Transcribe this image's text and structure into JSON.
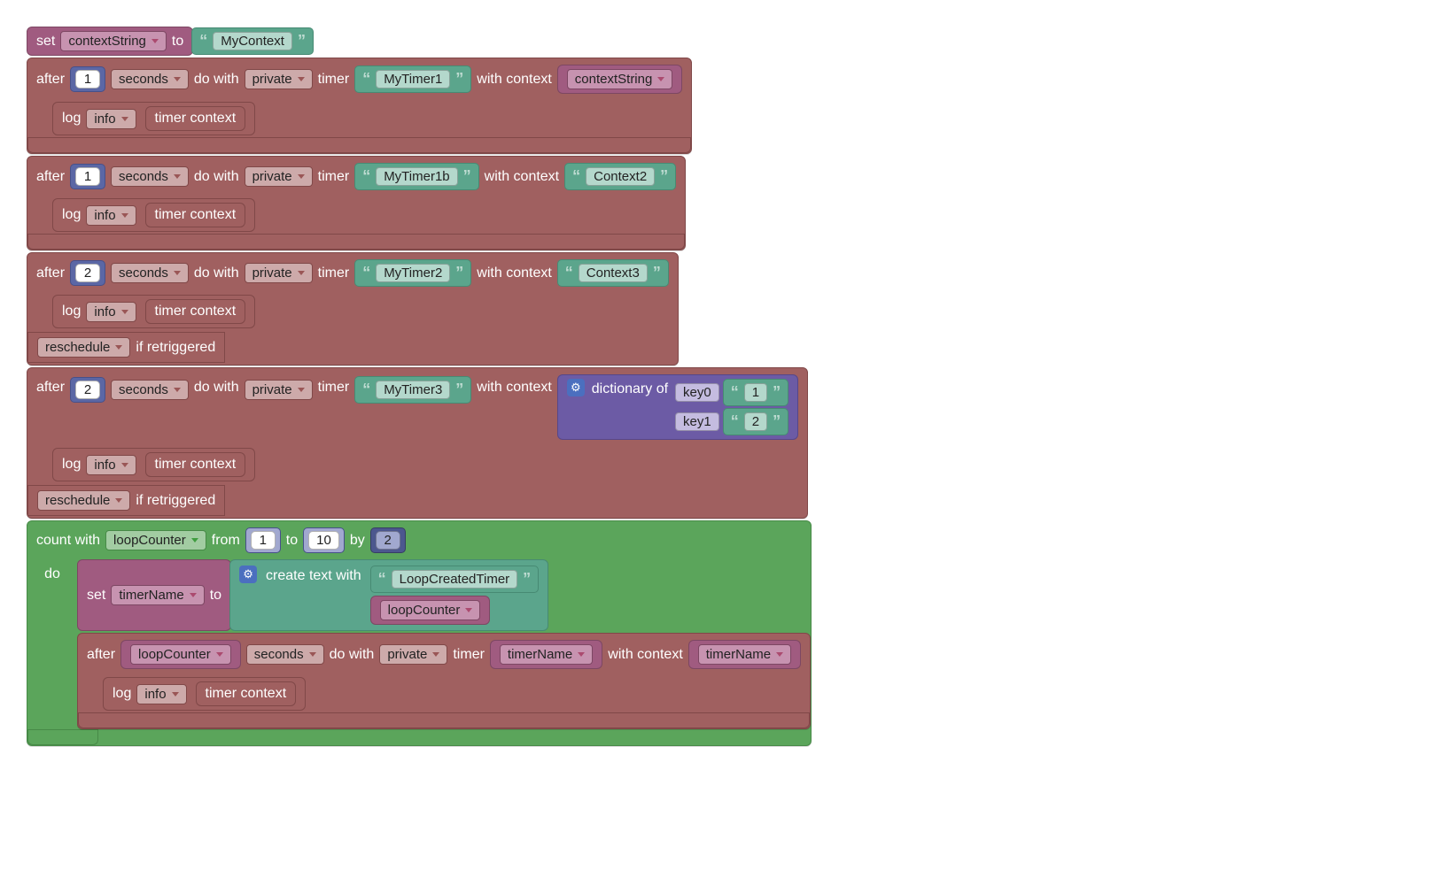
{
  "set1": {
    "label_set": "set",
    "var": "contextString",
    "label_to": "to",
    "value": "MyContext"
  },
  "timer1": {
    "after": "after",
    "num": "1",
    "unit": "seconds",
    "do_with": "do with",
    "scope": "private",
    "timer_kw": "timer",
    "name": "MyTimer1",
    "with_ctx": "with context",
    "ctx_var": "contextString",
    "log": {
      "log": "log",
      "level": "info",
      "text": "timer context"
    }
  },
  "timer1b": {
    "after": "after",
    "num": "1",
    "unit": "seconds",
    "do_with": "do with",
    "scope": "private",
    "timer_kw": "timer",
    "name": "MyTimer1b",
    "with_ctx": "with context",
    "ctx_str": "Context2",
    "log": {
      "log": "log",
      "level": "info",
      "text": "timer context"
    }
  },
  "timer2": {
    "after": "after",
    "num": "2",
    "unit": "seconds",
    "do_with": "do with",
    "scope": "private",
    "timer_kw": "timer",
    "name": "MyTimer2",
    "with_ctx": "with context",
    "ctx_str": "Context3",
    "log": {
      "log": "log",
      "level": "info",
      "text": "timer context"
    },
    "resched": {
      "mode": "reschedule",
      "suffix": "if retriggered"
    }
  },
  "timer3": {
    "after": "after",
    "num": "2",
    "unit": "seconds",
    "do_with": "do with",
    "scope": "private",
    "timer_kw": "timer",
    "name": "MyTimer3",
    "with_ctx": "with context",
    "dict": {
      "label": "dictionary of",
      "k0": "key0",
      "v0": "1",
      "k1": "key1",
      "v1": "2"
    },
    "log": {
      "log": "log",
      "level": "info",
      "text": "timer context"
    },
    "resched": {
      "mode": "reschedule",
      "suffix": "if retriggered"
    }
  },
  "loop": {
    "count_with": "count with",
    "var": "loopCounter",
    "from": "from",
    "from_n": "1",
    "to": "to",
    "to_n": "10",
    "by": "by",
    "by_n": "2",
    "do": "do",
    "set": {
      "label_set": "set",
      "var": "timerName",
      "label_to": "to",
      "create": "create text with",
      "s1": "LoopCreatedTimer",
      "s2var": "loopCounter"
    },
    "inner_timer": {
      "after": "after",
      "num_var": "loopCounter",
      "unit": "seconds",
      "do_with": "do with",
      "scope": "private",
      "timer_kw": "timer",
      "name_var": "timerName",
      "with_ctx": "with context",
      "ctx_var": "timerName",
      "log": {
        "log": "log",
        "level": "info",
        "text": "timer context"
      }
    }
  },
  "glyphs": {
    "lq": "“",
    "rq": "”",
    "gear": "⚙"
  }
}
